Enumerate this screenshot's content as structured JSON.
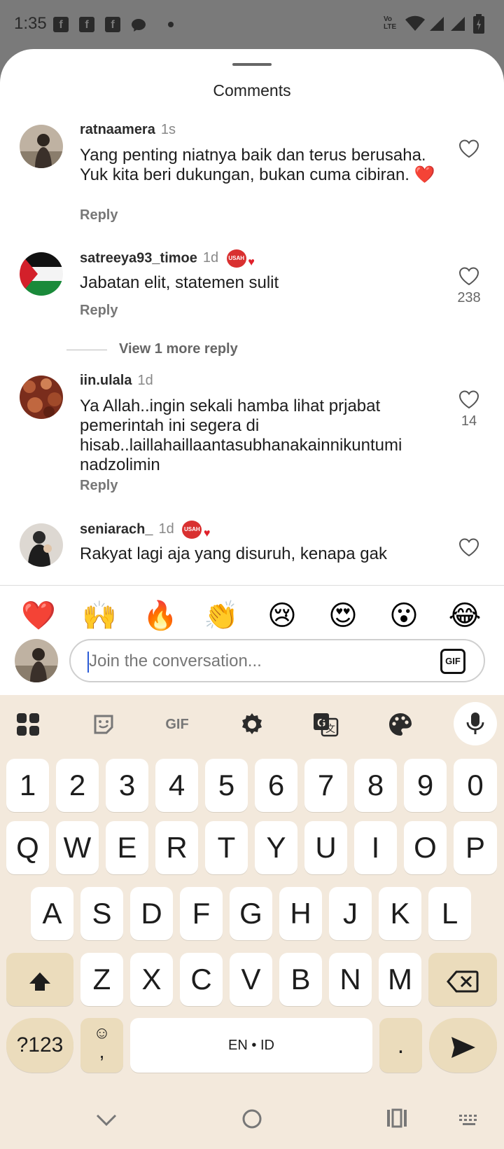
{
  "status_bar": {
    "time": "1:35",
    "lte_label": "Vo LTE",
    "notif_icons": [
      "facebook-icon",
      "facebook-icon",
      "facebook-icon",
      "chat-bubble-icon",
      "dot-icon"
    ],
    "right_icons": [
      "wifi-icon",
      "signal-icon",
      "signal-icon",
      "battery-icon"
    ]
  },
  "sheet": {
    "title": "Comments"
  },
  "comments": [
    {
      "user": "ratnaamera",
      "time": "1s",
      "text": "Yang penting niatnya baik dan terus berusaha. Yuk kita beri dukungan, bukan cuma cibiran. ❤️",
      "reply_label": "Reply",
      "like_count": "",
      "has_badge": false
    },
    {
      "user": "satreeya93_timoe",
      "time": "1d",
      "text": "Jabatan elit, statemen sulit",
      "reply_label": "Reply",
      "like_count": "238",
      "has_badge": true
    },
    {
      "user": "iin.ulala",
      "time": "1d",
      "text": "Ya Allah..ingin sekali hamba lihat prjabat pemerintah ini segera di hisab..laillahaillaantasubhanakainnikuntumi nadzolimin",
      "reply_label": "Reply",
      "like_count": "14",
      "has_badge": false
    },
    {
      "user": "seniarach_",
      "time": "1d",
      "text": "Rakyat lagi aja yang disuruh, kenapa gak",
      "reply_label": "",
      "like_count": "",
      "has_badge": true
    }
  ],
  "view_more_reply": "View 1 more reply",
  "badge_text": "USAH DOO",
  "composer": {
    "emojis": [
      "❤️",
      "🙌",
      "🔥",
      "👏",
      "😢",
      "😍",
      "😮",
      "😂"
    ],
    "placeholder": "Join the conversation...",
    "gif_label": "GIF"
  },
  "keyboard": {
    "toolbar": [
      "apps-grid-icon",
      "sticker-icon",
      "gif-icon",
      "settings-gear-icon",
      "translate-icon",
      "palette-icon",
      "mic-icon"
    ],
    "toolbar_gif_label": "GIF",
    "row_numbers": [
      "1",
      "2",
      "3",
      "4",
      "5",
      "6",
      "7",
      "8",
      "9",
      "0"
    ],
    "row_qwerty": [
      "Q",
      "W",
      "E",
      "R",
      "T",
      "Y",
      "U",
      "I",
      "O",
      "P"
    ],
    "row_asdf": [
      "A",
      "S",
      "D",
      "F",
      "G",
      "H",
      "J",
      "K",
      "L"
    ],
    "row_zxcv": [
      "Z",
      "X",
      "C",
      "V",
      "B",
      "N",
      "M"
    ],
    "symbols_label": "?123",
    "emoji_comma_top": "☺",
    "emoji_comma_bottom": ",",
    "space_label": "EN • ID",
    "period_label": "."
  },
  "nav_bar": {
    "icons": [
      "nav-back-down-icon",
      "nav-home-icon",
      "nav-recents-icon",
      "nav-keyboard-icon"
    ]
  }
}
